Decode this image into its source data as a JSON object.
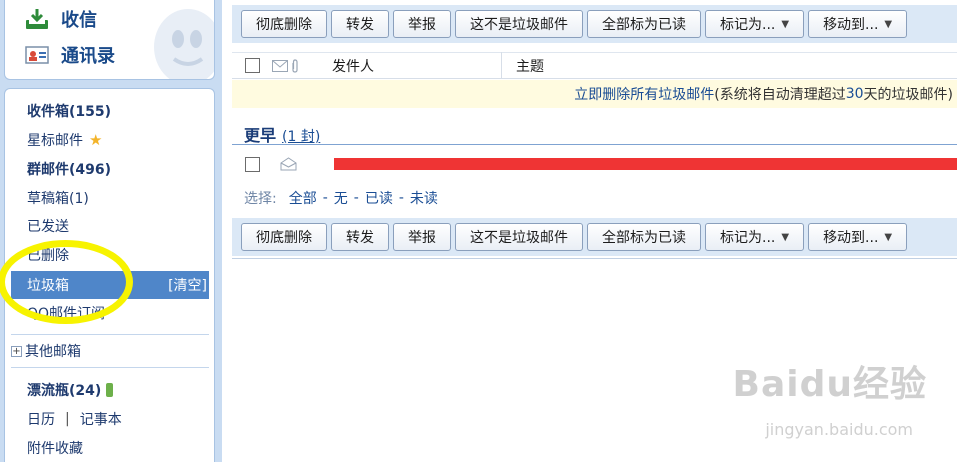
{
  "sidebar": {
    "top": {
      "receive": "收信",
      "contacts": "通讯录"
    },
    "folders": [
      {
        "label": "收件箱(155)",
        "bold": true
      },
      {
        "label": "星标邮件",
        "bold": false,
        "star": true
      },
      {
        "label": "群邮件(496)",
        "bold": true
      },
      {
        "label": "草稿箱(1)",
        "bold": false
      },
      {
        "label": "已发送",
        "bold": false
      },
      {
        "label": "已删除",
        "bold": false
      },
      {
        "label": "垃圾箱",
        "bold": false,
        "selected": true,
        "action": "[清空]"
      },
      {
        "label": "QQ邮件订阅",
        "bold": false
      }
    ],
    "other_mailboxes": "其他邮箱",
    "drift_bottle": "漂流瓶(24)",
    "calendar": "日历",
    "separator": "|",
    "notepad": "记事本",
    "attachments": "附件收藏"
  },
  "toolbar": {
    "delete_forever": "彻底删除",
    "forward": "转发",
    "report": "举报",
    "not_spam": "这不是垃圾邮件",
    "mark_all_read": "全部标为已读",
    "mark_as": "标记为...",
    "move_to": "移动到..."
  },
  "list": {
    "col_sender": "发件人",
    "col_subject": "主题",
    "notice_link": "立即删除所有垃圾邮件",
    "notice_pre": " (系统将自动清理超过 ",
    "notice_days": "30",
    "notice_post": " 天的垃圾邮件)",
    "group_title": "更早",
    "group_count": "(1 封)"
  },
  "select": {
    "label": "选择:",
    "all": "全部",
    "none": "无",
    "read": "已读",
    "unread": "未读",
    "dash": "-"
  },
  "watermark": {
    "brand": "Baidu经验",
    "url": "jingyan.baidu.com"
  },
  "colors": {
    "sidebar_bg": "#c9dcf2",
    "selected_bg": "#4f86c9",
    "highlight_circle": "#f7f300",
    "redaction": "#ef3434"
  }
}
